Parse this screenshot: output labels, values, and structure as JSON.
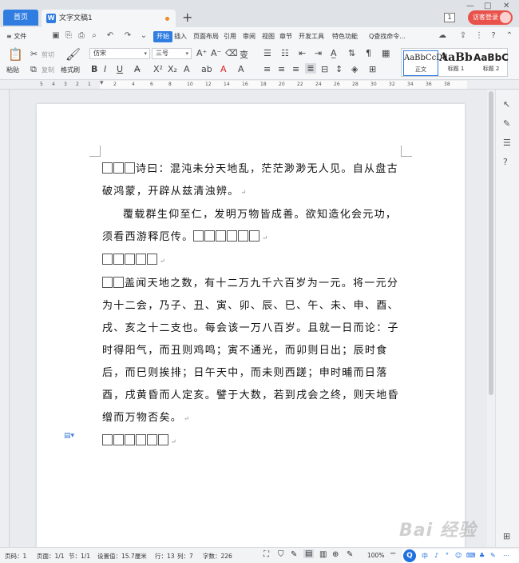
{
  "titlebar": {
    "home_tab": "首页",
    "doc_tab": "文字文稿1",
    "doc_tab_icon": "W",
    "new_tab": "+",
    "badge": "1",
    "visitor_button": "访客登录",
    "win_min": "—",
    "win_max": "□",
    "win_close": "✕"
  },
  "menubar": {
    "file": "≡ 文件",
    "items": [
      "开始",
      "插入",
      "页面布局",
      "引用",
      "审阅",
      "视图",
      "章节",
      "开发工具",
      "特色功能"
    ],
    "search": "Q查找命令...",
    "active_item": "开始"
  },
  "ribbon": {
    "paste": "粘贴",
    "cut": "剪切",
    "copy": "复制",
    "format_painter": "格式刷",
    "font_name": "仿宋",
    "font_size": "三号",
    "styles": [
      {
        "preview": "AaBbCcDd",
        "label": "正文"
      },
      {
        "preview": "AaBb",
        "label": "标题 1"
      },
      {
        "preview": "AaBbC",
        "label": "标题 2"
      }
    ]
  },
  "ruler": {
    "left_ticks": [
      "5",
      "4",
      "3",
      "2",
      "1"
    ],
    "ticks": [
      "2",
      "4",
      "6",
      "8",
      "10",
      "12",
      "14",
      "16",
      "18",
      "20",
      "22",
      "24",
      "26",
      "28",
      "30",
      "32",
      "34",
      "36",
      "38"
    ]
  },
  "document": {
    "paragraphs": [
      {
        "boxes_before": 3,
        "text": "诗曰：混沌未分天地乱，茫茫渺渺无人见。自从盘古破鸿蒙，开辟从兹清浊辨。",
        "boxes_after": 0
      },
      {
        "boxes_before": 0,
        "text": "覆载群生仰至仁，发明万物皆成善。欲知造化会元功，须看西游释厄传。",
        "boxes_after": 6
      },
      {
        "boxes_before": 5,
        "text": "",
        "boxes_after": 0
      },
      {
        "boxes_before": 2,
        "text": "盖闻天地之数，有十二万九千六百岁为一元。将一元分为十二会，乃子、丑、寅、卯、辰、巳、午、未、申、酉、戌、亥之十二支也。每会该一万八百岁。且就一日而论：子时得阳气，而丑则鸡鸣；寅不通光，而卯则日出；辰时食后，而巳则挨排；日午天中，而未则西蹉；申时晡而日落酉，戌黄昏而人定亥。譬于大数，若到戌会之终，则天地昏缯而万物否矣。",
        "boxes_after": 0
      },
      {
        "boxes_before": 6,
        "text": "",
        "boxes_after": 0
      }
    ],
    "paragraph_mark": "↵"
  },
  "statusbar": {
    "page_num": "页码：1",
    "pages": "页面：1/1",
    "section": "节：1/1",
    "setting": "设置值：15.7厘米",
    "row": "行：13",
    "col": "列：7",
    "words": "字数：226",
    "zoom": "100%",
    "ime_items": [
      "中",
      "♪",
      "°",
      "☺",
      "⌨",
      "♣",
      "✎",
      "⋯"
    ]
  },
  "watermark": "Bai 经验",
  "colors": {
    "accent": "#2f7de1",
    "visitor": "#e9524a",
    "page_bg": "#ffffff",
    "workspace": "#e9ebee"
  }
}
